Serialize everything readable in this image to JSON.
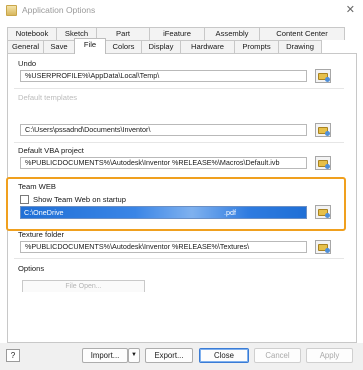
{
  "window": {
    "title": "Application Options",
    "close_glyph": "✕"
  },
  "tabs_row1": [
    "Notebook",
    "Sketch",
    "Part",
    "iFeature",
    "Assembly",
    "Content Center"
  ],
  "tabs_row2": [
    "General",
    "Save",
    "File",
    "Colors",
    "Display",
    "Hardware",
    "Prompts",
    "Drawing"
  ],
  "active_tab": "File",
  "undo": {
    "label": "Undo",
    "value": "%USERPROFILE%\\AppData\\Local\\Temp\\"
  },
  "templates": {
    "label": "Default templates",
    "value": "C:\\Users\\pssadnd\\Documents\\Inventor\\"
  },
  "vba": {
    "label": "Default VBA project",
    "value": "%PUBLICDOCUMENTS%\\Autodesk\\Inventor %RELEASE%\\Macros\\Default.ivb"
  },
  "team_web": {
    "label": "Team WEB",
    "checkbox_label": "Show Team Web on startup",
    "checked": false,
    "value_prefix": "C:\\OneDrive",
    "value_suffix": ".pdf"
  },
  "texture": {
    "label": "Texture folder",
    "value": "%PUBLICDOCUMENTS%\\Autodesk\\Inventor %RELEASE%\\Textures\\"
  },
  "options": {
    "label": "Options",
    "button_label": "File Open..."
  },
  "footer": {
    "help_glyph": "?",
    "import_label": "Import...",
    "import_menu_glyph": "▼",
    "export_label": "Export...",
    "close_label": "Close",
    "cancel_label": "Cancel",
    "apply_label": "Apply"
  },
  "colors": {
    "highlight_border": "#f0a01e",
    "selection": "#1f6fd6"
  },
  "icons": {
    "browse": "folder-browse-icon",
    "app": "application-options-icon"
  }
}
